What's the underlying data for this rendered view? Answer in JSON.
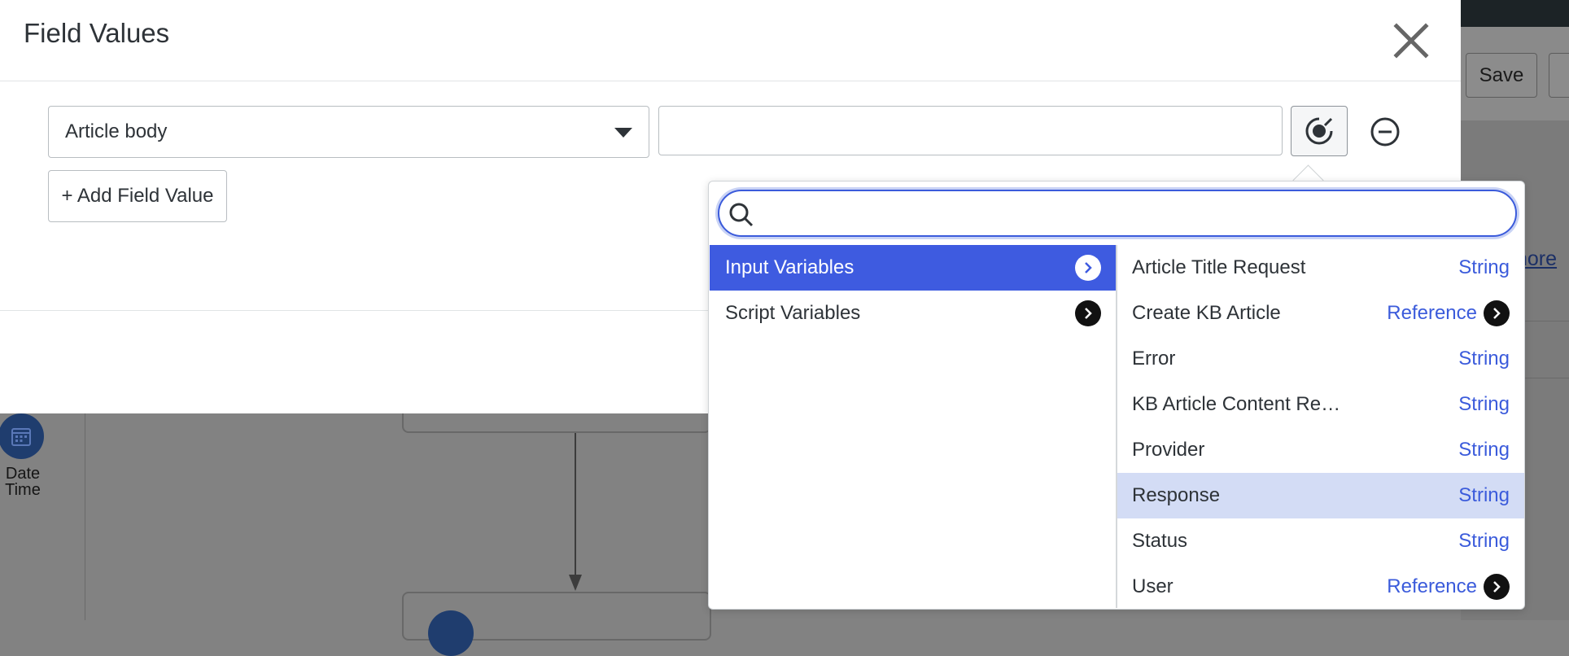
{
  "background": {
    "save_label": "Save",
    "more_link": "nore",
    "date_time_label": [
      "Date",
      "Time"
    ]
  },
  "modal": {
    "title": "Field Values",
    "field_select_value": "Article body",
    "value_input": "",
    "add_field_value_label": "+ Add Field Value"
  },
  "picker": {
    "search_placeholder": "",
    "categories": [
      {
        "label": "Input Variables",
        "active": true
      },
      {
        "label": "Script Variables",
        "active": false
      }
    ],
    "variables": [
      {
        "name": "Article Title Request",
        "type": "String"
      },
      {
        "name": "Create KB Article",
        "type": "Reference",
        "expandable": true
      },
      {
        "name": "Error",
        "type": "String"
      },
      {
        "name": "KB Article Content Re…",
        "type": "String"
      },
      {
        "name": "Provider",
        "type": "String"
      },
      {
        "name": "Response",
        "type": "String",
        "highlighted": true
      },
      {
        "name": "Status",
        "type": "String"
      },
      {
        "name": "User",
        "type": "Reference",
        "expandable": true
      }
    ]
  },
  "colors": {
    "accent": "#3e5be0",
    "highlight_row": "#d3dcf5",
    "type_text": "#3b5bdb"
  }
}
